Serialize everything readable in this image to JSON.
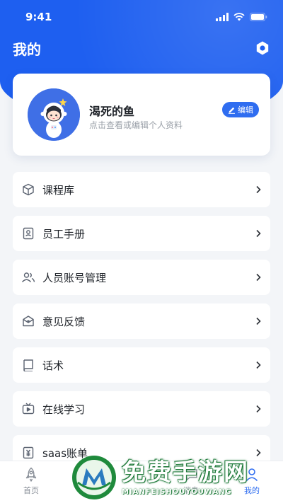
{
  "status_bar": {
    "time": "9:41"
  },
  "header": {
    "title": "我的"
  },
  "profile": {
    "name": "渴死的鱼",
    "hint": "点击查看或编辑个人资料",
    "edit_label": "编辑"
  },
  "menu": {
    "items": [
      {
        "label": "课程库",
        "icon": "cube-icon"
      },
      {
        "label": "员工手册",
        "icon": "handbook-icon"
      },
      {
        "label": "人员账号管理",
        "icon": "users-icon"
      },
      {
        "label": "意见反馈",
        "icon": "feedback-icon"
      },
      {
        "label": "话术",
        "icon": "book-icon"
      },
      {
        "label": "在线学习",
        "icon": "tv-icon"
      },
      {
        "label": "saas账单",
        "icon": "bill-icon"
      }
    ]
  },
  "tabbar": {
    "tabs": [
      {
        "label": "首页",
        "icon": "rocket-icon",
        "active": false
      },
      {
        "label": "消息",
        "icon": "message-icon",
        "active": false
      },
      {
        "label": "我的",
        "icon": "user-icon",
        "active": true
      }
    ]
  },
  "watermark": {
    "cn": "免费手游网",
    "en": "MIANFEISHOUYOUWANG"
  },
  "colors": {
    "primary": "#1e5ff0",
    "accent": "#2f6df0",
    "background": "#f3f5f8"
  }
}
